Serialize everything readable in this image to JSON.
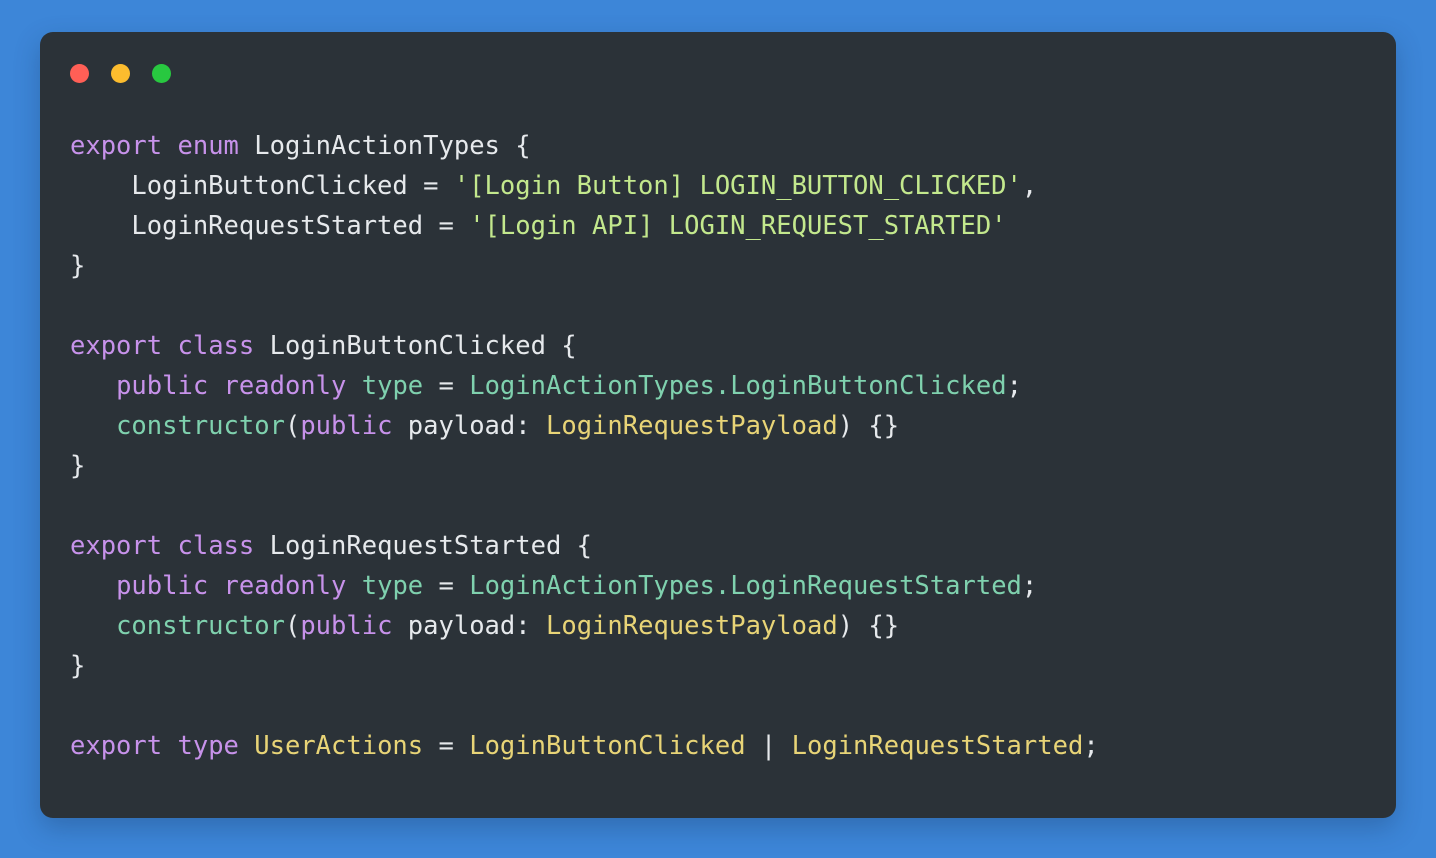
{
  "window": {
    "traffic_lights": [
      {
        "name": "close-button",
        "color": "#ff5f56"
      },
      {
        "name": "minimize-button",
        "color": "#fcbc2e"
      },
      {
        "name": "maximize-button",
        "color": "#28c840"
      }
    ]
  },
  "theme": {
    "page_background": "#3d86d8",
    "card_background": "#2b3238",
    "keyword": "#c792ea",
    "identifier": "#e6e9ec",
    "string": "#c3e88d",
    "type": "#e8d477",
    "member": "#7fd1ae",
    "function": "#7fd1ae",
    "punctuation": "#e6e9ec"
  },
  "code": {
    "language": "typescript",
    "plain_text": "export enum LoginActionTypes {\n    LoginButtonClicked = '[Login Button] LOGIN_BUTTON_CLICKED',\n    LoginRequestStarted = '[Login API] LOGIN_REQUEST_STARTED'\n}\n\nexport class LoginButtonClicked {\n   public readonly type = LoginActionTypes.LoginButtonClicked;\n   constructor(public payload: LoginRequestPayload) {}\n}\n\nexport class LoginRequestStarted {\n   public readonly type = LoginActionTypes.LoginRequestStarted;\n   constructor(public payload: LoginRequestPayload) {}\n}\n\nexport type UserActions = LoginButtonClicked | LoginRequestStarted;",
    "lines": [
      {
        "tokens": [
          {
            "t": "export",
            "c": "kw"
          },
          {
            "t": " ",
            "c": "punc"
          },
          {
            "t": "enum",
            "c": "kw"
          },
          {
            "t": " ",
            "c": "punc"
          },
          {
            "t": "LoginActionTypes",
            "c": "id"
          },
          {
            "t": " {",
            "c": "punc"
          }
        ]
      },
      {
        "tokens": [
          {
            "t": "    ",
            "c": "punc"
          },
          {
            "t": "LoginButtonClicked",
            "c": "id"
          },
          {
            "t": " = ",
            "c": "op"
          },
          {
            "t": "'[Login Button] LOGIN_BUTTON_CLICKED'",
            "c": "str"
          },
          {
            "t": ",",
            "c": "punc"
          }
        ]
      },
      {
        "tokens": [
          {
            "t": "    ",
            "c": "punc"
          },
          {
            "t": "LoginRequestStarted",
            "c": "id"
          },
          {
            "t": " = ",
            "c": "op"
          },
          {
            "t": "'[Login API] LOGIN_REQUEST_STARTED'",
            "c": "str"
          }
        ]
      },
      {
        "tokens": [
          {
            "t": "}",
            "c": "punc"
          }
        ]
      },
      {
        "tokens": []
      },
      {
        "tokens": [
          {
            "t": "export",
            "c": "kw"
          },
          {
            "t": " ",
            "c": "punc"
          },
          {
            "t": "class",
            "c": "kw"
          },
          {
            "t": " ",
            "c": "punc"
          },
          {
            "t": "LoginButtonClicked",
            "c": "id"
          },
          {
            "t": " {",
            "c": "punc"
          }
        ]
      },
      {
        "tokens": [
          {
            "t": "   ",
            "c": "punc"
          },
          {
            "t": "public",
            "c": "kw"
          },
          {
            "t": " ",
            "c": "punc"
          },
          {
            "t": "readonly",
            "c": "kw"
          },
          {
            "t": " ",
            "c": "punc"
          },
          {
            "t": "type",
            "c": "fn"
          },
          {
            "t": " = ",
            "c": "op"
          },
          {
            "t": "LoginActionTypes.LoginButtonClicked",
            "c": "mem"
          },
          {
            "t": ";",
            "c": "punc"
          }
        ]
      },
      {
        "tokens": [
          {
            "t": "   ",
            "c": "punc"
          },
          {
            "t": "constructor",
            "c": "fn"
          },
          {
            "t": "(",
            "c": "punc"
          },
          {
            "t": "public",
            "c": "kw"
          },
          {
            "t": " ",
            "c": "punc"
          },
          {
            "t": "payload",
            "c": "id"
          },
          {
            "t": ": ",
            "c": "punc"
          },
          {
            "t": "LoginRequestPayload",
            "c": "type"
          },
          {
            "t": ") {}",
            "c": "punc"
          }
        ]
      },
      {
        "tokens": [
          {
            "t": "}",
            "c": "punc"
          }
        ]
      },
      {
        "tokens": []
      },
      {
        "tokens": [
          {
            "t": "export",
            "c": "kw"
          },
          {
            "t": " ",
            "c": "punc"
          },
          {
            "t": "class",
            "c": "kw"
          },
          {
            "t": " ",
            "c": "punc"
          },
          {
            "t": "LoginRequestStarted",
            "c": "id"
          },
          {
            "t": " {",
            "c": "punc"
          }
        ]
      },
      {
        "tokens": [
          {
            "t": "   ",
            "c": "punc"
          },
          {
            "t": "public",
            "c": "kw"
          },
          {
            "t": " ",
            "c": "punc"
          },
          {
            "t": "readonly",
            "c": "kw"
          },
          {
            "t": " ",
            "c": "punc"
          },
          {
            "t": "type",
            "c": "fn"
          },
          {
            "t": " = ",
            "c": "op"
          },
          {
            "t": "LoginActionTypes.LoginRequestStarted",
            "c": "mem"
          },
          {
            "t": ";",
            "c": "punc"
          }
        ]
      },
      {
        "tokens": [
          {
            "t": "   ",
            "c": "punc"
          },
          {
            "t": "constructor",
            "c": "fn"
          },
          {
            "t": "(",
            "c": "punc"
          },
          {
            "t": "public",
            "c": "kw"
          },
          {
            "t": " ",
            "c": "punc"
          },
          {
            "t": "payload",
            "c": "id"
          },
          {
            "t": ": ",
            "c": "punc"
          },
          {
            "t": "LoginRequestPayload",
            "c": "type"
          },
          {
            "t": ") {}",
            "c": "punc"
          }
        ]
      },
      {
        "tokens": [
          {
            "t": "}",
            "c": "punc"
          }
        ]
      },
      {
        "tokens": []
      },
      {
        "tokens": [
          {
            "t": "export",
            "c": "kw"
          },
          {
            "t": " ",
            "c": "punc"
          },
          {
            "t": "type",
            "c": "kw"
          },
          {
            "t": " ",
            "c": "punc"
          },
          {
            "t": "UserActions",
            "c": "type"
          },
          {
            "t": " = ",
            "c": "op"
          },
          {
            "t": "LoginButtonClicked",
            "c": "type"
          },
          {
            "t": " | ",
            "c": "punc"
          },
          {
            "t": "LoginRequestStarted",
            "c": "type"
          },
          {
            "t": ";",
            "c": "punc"
          }
        ]
      }
    ]
  }
}
